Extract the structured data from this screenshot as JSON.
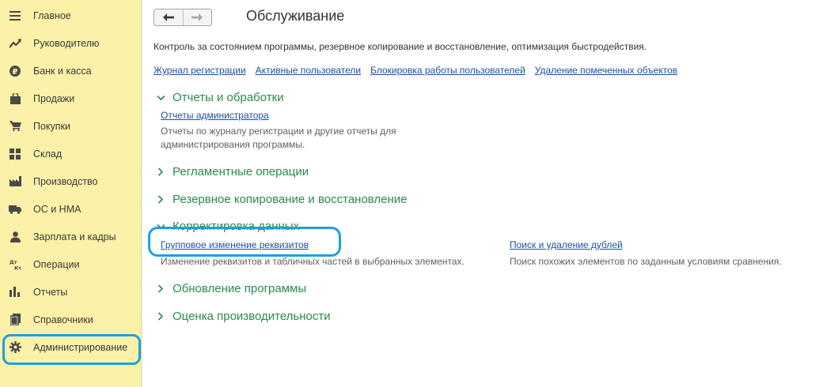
{
  "sidebar": {
    "items": [
      {
        "label": "Главное",
        "icon": "menu-icon"
      },
      {
        "label": "Руководителю",
        "icon": "trend-icon"
      },
      {
        "label": "Банк и касса",
        "icon": "ruble-coin-icon"
      },
      {
        "label": "Продажи",
        "icon": "shopping-bag-icon"
      },
      {
        "label": "Покупки",
        "icon": "cart-icon"
      },
      {
        "label": "Склад",
        "icon": "warehouse-icon"
      },
      {
        "label": "Производство",
        "icon": "factory-icon"
      },
      {
        "label": "ОС и НМА",
        "icon": "truck-icon"
      },
      {
        "label": "Зарплата и кадры",
        "icon": "person-icon"
      },
      {
        "label": "Операции",
        "icon": "debit-credit-icon"
      },
      {
        "label": "Отчеты",
        "icon": "bar-chart-icon"
      },
      {
        "label": "Справочники",
        "icon": "books-icon"
      },
      {
        "label": "Администрирование",
        "icon": "gear-icon"
      }
    ],
    "active": "Администрирование"
  },
  "header": {
    "title": "Обслуживание",
    "back_icon": "arrow-left-icon",
    "forward_icon": "arrow-right-icon"
  },
  "description": "Контроль за состоянием программы, резервное копирование и восстановление, оптимизация быстродействия.",
  "quick_links": [
    "Журнал регистрации",
    "Активные пользователи",
    "Блокировка работы пользователей",
    "Удаление помеченных объектов"
  ],
  "groups": {
    "reports": {
      "title": "Отчеты и обработки",
      "link": "Отчеты администратора",
      "desc_line1": "Отчеты по журналу регистрации и другие отчеты для",
      "desc_line2": "администрирования программы."
    },
    "routine": {
      "title": "Регламентные операции"
    },
    "backup": {
      "title": "Резервное копирование и восстановление"
    },
    "correction": {
      "title": "Корректировка данных",
      "link_left": "Групповое изменение реквизитов",
      "desc_left": "Изменение реквизитов и табличных частей в выбранных элементах.",
      "link_right": "Поиск и удаление дублей",
      "desc_right": "Поиск похожих элементов по заданным условиям сравнения."
    },
    "update": {
      "title": "Обновление программы"
    },
    "performance": {
      "title": "Оценка производительности"
    }
  },
  "colors": {
    "sidebar_bg": "#fbf1a8",
    "group_title": "#2a8a4d",
    "link": "#1c4f9e",
    "highlight": "#1ba0e2"
  }
}
